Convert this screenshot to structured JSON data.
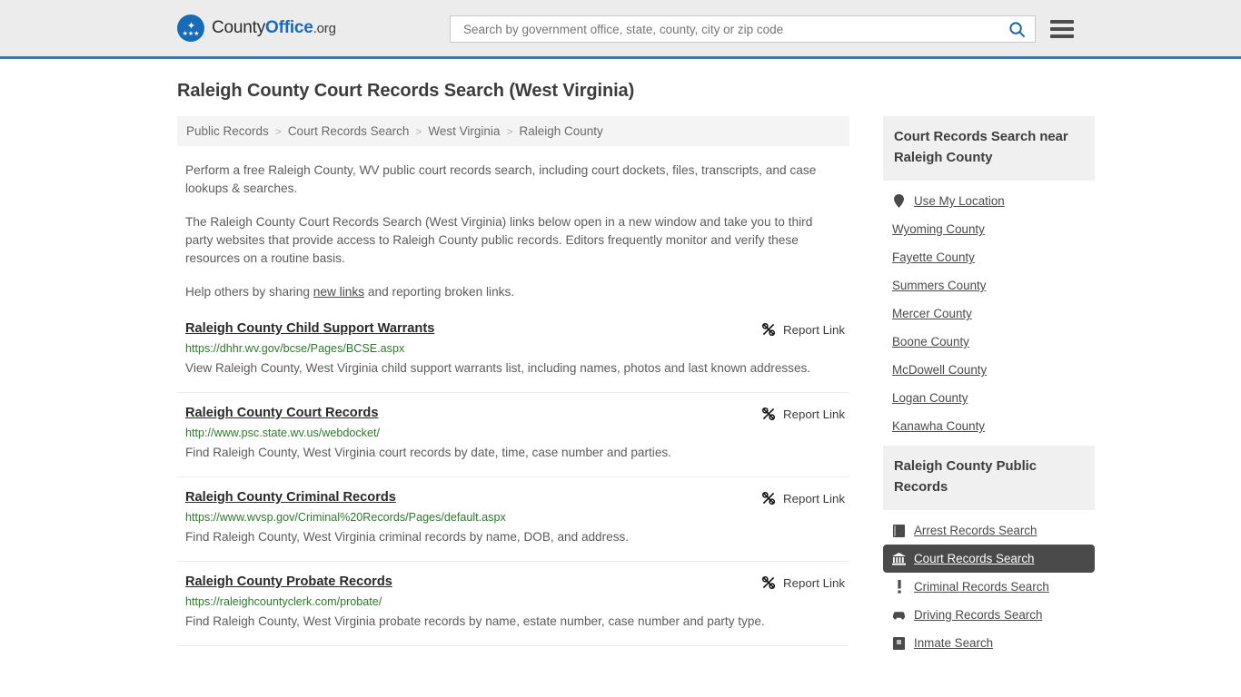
{
  "header": {
    "logo": {
      "name_part1": "County",
      "name_part2": "Office",
      "tld": ".org",
      "eagle_glyph": "✦",
      "stars_glyph": "★★★"
    },
    "search": {
      "placeholder": "Search by government office, state, county, city or zip code",
      "value": "",
      "search_icon": "search-icon",
      "menu_icon": "hamburger-menu-icon"
    }
  },
  "page": {
    "title": "Raleigh County Court Records Search (West Virginia)"
  },
  "breadcrumb": {
    "separator": ">",
    "items": [
      {
        "label": "Public Records"
      },
      {
        "label": "Court Records Search"
      },
      {
        "label": "West Virginia"
      },
      {
        "label": "Raleigh County"
      }
    ]
  },
  "intro": {
    "p1": "Perform a free Raleigh County, WV public court records search, including court dockets, files, transcripts, and case lookups & searches.",
    "p2": "The Raleigh County Court Records Search (West Virginia) links below open in a new window and take you to third party websites that provide access to Raleigh County public records. Editors frequently monitor and verify these resources on a routine basis.",
    "p3_before": "Help others by sharing ",
    "p3_link": "new links",
    "p3_after": " and reporting broken links."
  },
  "results": {
    "report_label": "Report Link",
    "report_icon": "broken-link-icon",
    "items": [
      {
        "title": "Raleigh County Child Support Warrants",
        "url": "https://dhhr.wv.gov/bcse/Pages/BCSE.aspx",
        "description": "View Raleigh County, West Virginia child support warrants list, including names, photos and last known addresses."
      },
      {
        "title": "Raleigh County Court Records",
        "url": "http://www.psc.state.wv.us/webdocket/",
        "description": "Find Raleigh County, West Virginia court records by date, time, case number and parties."
      },
      {
        "title": "Raleigh County Criminal Records",
        "url": "https://www.wvsp.gov/Criminal%20Records/Pages/default.aspx",
        "description": "Find Raleigh County, West Virginia criminal records by name, DOB, and address."
      },
      {
        "title": "Raleigh County Probate Records",
        "url": "https://raleighcountyclerk.com/probate/",
        "description": "Find Raleigh County, West Virginia probate records by name, estate number, case number and party type."
      }
    ]
  },
  "sidebar": {
    "near_card": {
      "heading": "Court Records Search near Raleigh County",
      "items": [
        {
          "label": "Use My Location",
          "icon": "map-pin-icon",
          "has_icon": true
        },
        {
          "label": "Wyoming County",
          "has_icon": false
        },
        {
          "label": "Fayette County",
          "has_icon": false
        },
        {
          "label": "Summers County",
          "has_icon": false
        },
        {
          "label": "Mercer County",
          "has_icon": false
        },
        {
          "label": "Boone County",
          "has_icon": false
        },
        {
          "label": "McDowell County",
          "has_icon": false
        },
        {
          "label": "Logan County",
          "has_icon": false
        },
        {
          "label": "Kanawha County",
          "has_icon": false
        }
      ]
    },
    "public_records_card": {
      "heading": "Raleigh County Public Records",
      "items": [
        {
          "label": "Arrest Records Search",
          "icon": "book-icon",
          "active": false
        },
        {
          "label": "Court Records Search",
          "icon": "courthouse-icon",
          "active": true
        },
        {
          "label": "Criminal Records Search",
          "icon": "exclamation-icon",
          "active": false
        },
        {
          "label": "Driving Records Search",
          "icon": "car-icon",
          "active": false
        },
        {
          "label": "Inmate Search",
          "icon": "jail-building-icon",
          "active": false
        }
      ]
    }
  },
  "colors": {
    "header_bg": "#ececec",
    "header_border": "#3f77a8",
    "brand_blue": "#1a6bb5",
    "url_green": "#2d7a2d",
    "active_bg": "#4a4a4a"
  }
}
